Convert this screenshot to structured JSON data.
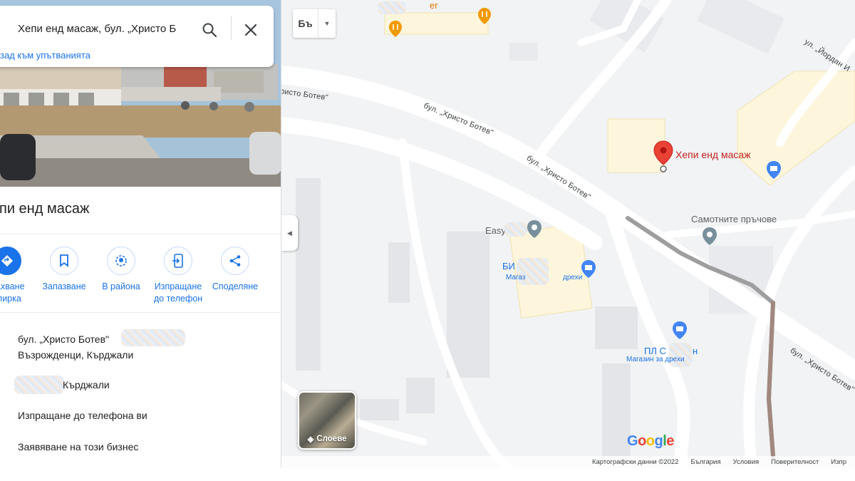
{
  "search": {
    "query": "Хепи енд масаж, бул. „Христо Б",
    "back_link": "зад към упътванията"
  },
  "place": {
    "title": "пи енд масаж"
  },
  "actions": [
    {
      "label_line1": "махване",
      "label_line2": "спирка",
      "icon": "directions-icon"
    },
    {
      "label_line1": "Запазване",
      "label_line2": "",
      "icon": "bookmark-icon"
    },
    {
      "label_line1": "В района",
      "label_line2": "",
      "icon": "nearby-icon"
    },
    {
      "label_line1": "Изпращане",
      "label_line2": "до телефон",
      "icon": "send-to-phone-icon"
    },
    {
      "label_line1": "Споделяне",
      "label_line2": "",
      "icon": "share-icon"
    }
  ],
  "info": {
    "address_line1": "бул. „Христо Ботев\"",
    "address_line2": "Възрожденци, Кърджали",
    "plus_code_city": "Кърджали",
    "send_to_phone": "Изпращане до телефона ви",
    "claim_business": "Заявяване на този бизнес"
  },
  "map": {
    "language_label": "Бъ",
    "layers_label": "Слоеве",
    "place_marker_label": "Хепи енд масаж",
    "roads": {
      "road_top_left": "ристо Ботев\"",
      "road_1": "бул. „Христо Ботев\"",
      "road_2": "бул. „Христо Ботев\"",
      "road_right": "бул. „Христо Ботев\"",
      "road_yordan": "ул. „Йордан И"
    },
    "pois": {
      "samotnite": "Самотните пръчове",
      "easy": "Easy",
      "bi_title": "БИ",
      "bi_sub": "Магаз",
      "bi_sub2": "дрехи",
      "pl_title": "ПЛ С",
      "pl_title_end": "н",
      "pl_sub": "Магазин за дрехи",
      "top_poi": "er"
    },
    "google_logo": "Google",
    "footer": {
      "map_data": "Картографски данни ©2022",
      "country": "България",
      "terms": "Условия",
      "privacy": "Поверителност",
      "extra": "Изпр"
    }
  },
  "colors": {
    "accent": "#1a73e8",
    "marker": "#ea4335",
    "building_yellow": "#fdf6dc",
    "map_bg": "#f1f3f4"
  }
}
